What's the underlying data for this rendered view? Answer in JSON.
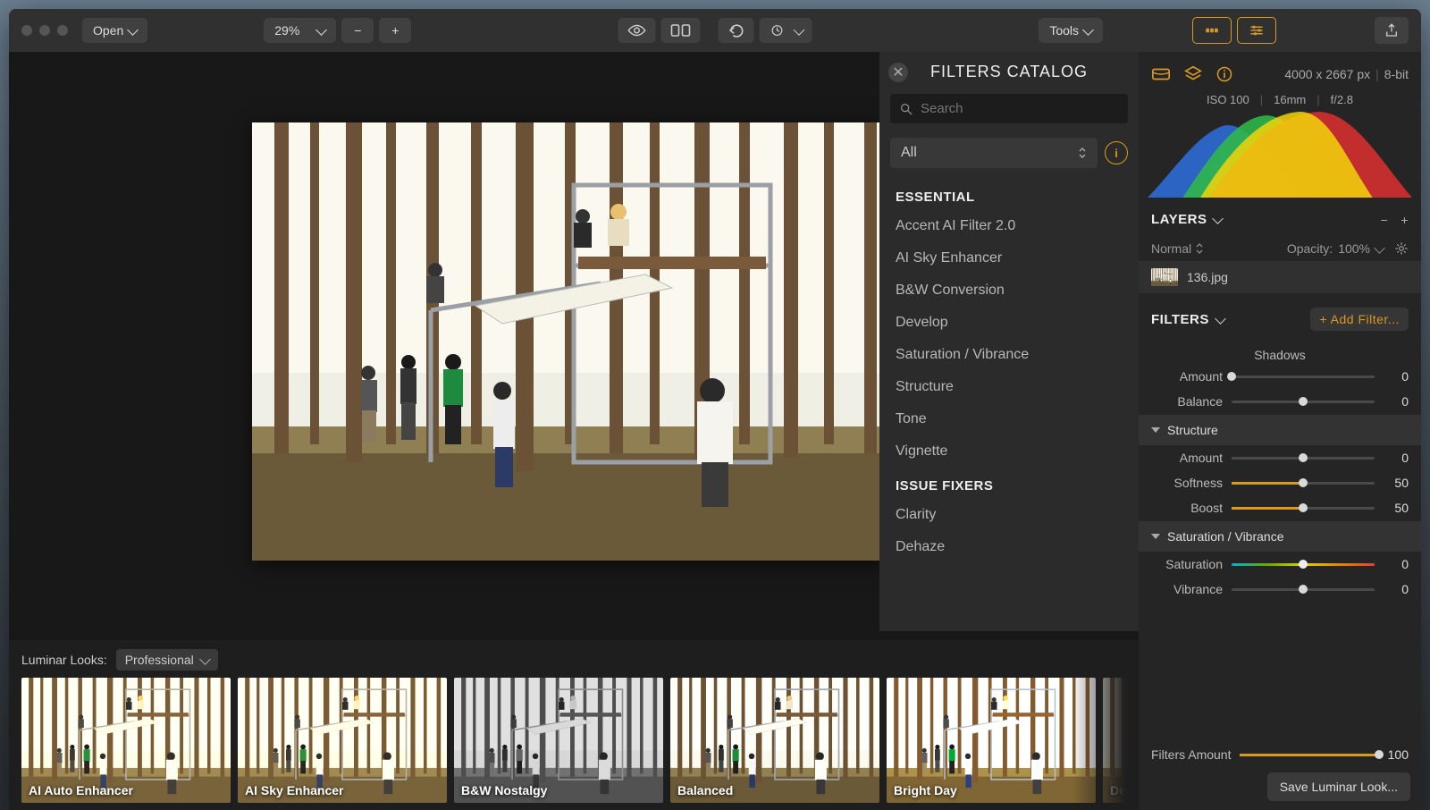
{
  "toolbar": {
    "open_label": "Open",
    "zoom": "29%",
    "tools_label": "Tools"
  },
  "catalog": {
    "title": "FILTERS CATALOG",
    "search_placeholder": "Search",
    "scope": "All",
    "groups": [
      {
        "name": "ESSENTIAL",
        "items": [
          "Accent AI Filter 2.0",
          "AI Sky Enhancer",
          "B&W Conversion",
          "Develop",
          "Saturation / Vibrance",
          "Structure",
          "Tone",
          "Vignette"
        ]
      },
      {
        "name": "ISSUE FIXERS",
        "items": [
          "Clarity",
          "Dehaze"
        ]
      }
    ]
  },
  "side": {
    "dimensions": "4000 x 2667 px",
    "bit_depth": "8-bit",
    "exif": {
      "iso": "ISO 100",
      "focal": "16mm",
      "aperture": "f/2.8"
    },
    "layers": {
      "title": "LAYERS",
      "blend_mode": "Normal",
      "opacity_label": "Opacity:",
      "opacity_value": "100%",
      "active_layer": "136.jpg"
    },
    "filters": {
      "title": "FILTERS",
      "add_label": "+ Add Filter...",
      "shadows_title": "Shadows",
      "groups": [
        {
          "name": null,
          "sliders": [
            {
              "label": "Amount",
              "value": 0,
              "mode": "zero"
            },
            {
              "label": "Balance",
              "value": 0,
              "mode": "center"
            }
          ]
        },
        {
          "name": "Structure",
          "sliders": [
            {
              "label": "Amount",
              "value": 0,
              "mode": "center"
            },
            {
              "label": "Softness",
              "value": 50,
              "mode": "half"
            },
            {
              "label": "Boost",
              "value": 50,
              "mode": "half"
            }
          ]
        },
        {
          "name": "Saturation / Vibrance",
          "sliders": [
            {
              "label": "Saturation",
              "value": 0,
              "mode": "sat"
            },
            {
              "label": "Vibrance",
              "value": 0,
              "mode": "center"
            }
          ]
        }
      ],
      "master_label": "Filters Amount",
      "master_value": 100,
      "save_label": "Save Luminar Look..."
    }
  },
  "strip": {
    "heading": "Luminar Looks:",
    "category": "Professional",
    "items": [
      {
        "label": "AI Auto Enhancer",
        "style": "warm"
      },
      {
        "label": "AI Sky Enhancer",
        "style": "warm"
      },
      {
        "label": "B&W Nostalgy",
        "style": "bw"
      },
      {
        "label": "Balanced",
        "style": "bal"
      },
      {
        "label": "Bright Day",
        "style": "bright"
      },
      {
        "label": "De",
        "style": "warm"
      }
    ]
  }
}
